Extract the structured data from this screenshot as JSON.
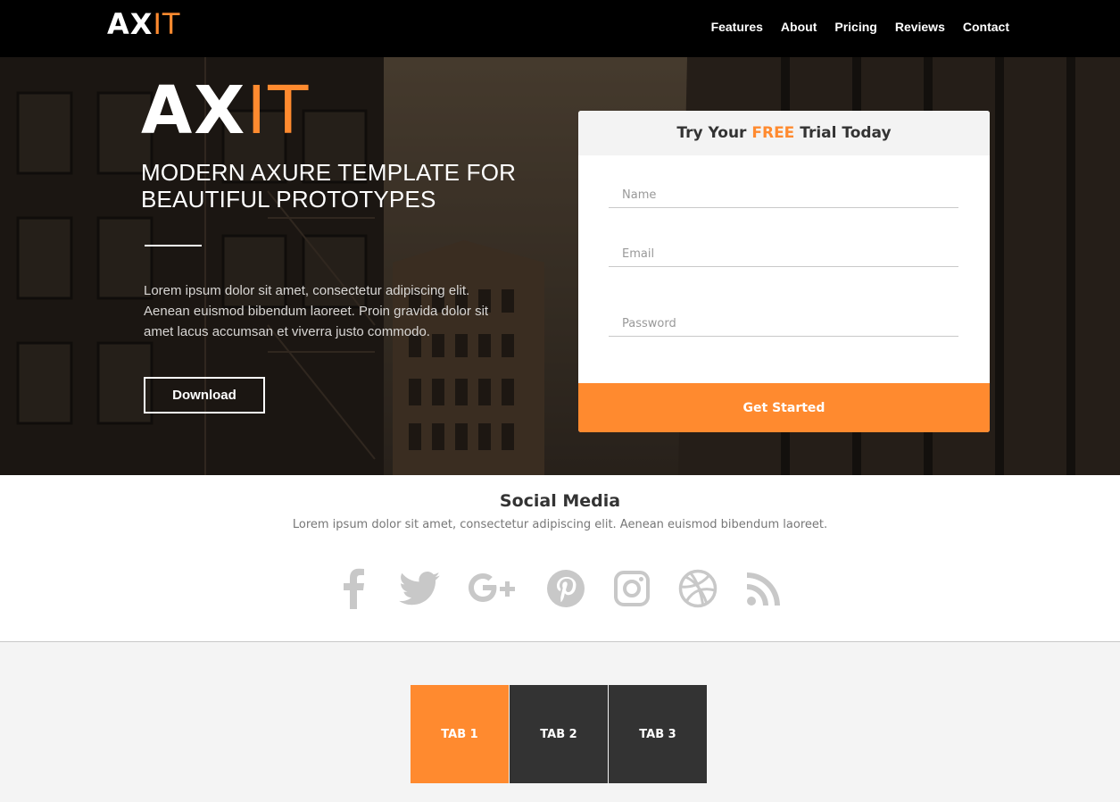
{
  "nav": {
    "logo_main": "AX",
    "logo_accent": "IT",
    "links": [
      "Features",
      "About",
      "Pricing",
      "Reviews",
      "Contact"
    ]
  },
  "hero": {
    "logo_main": "AX",
    "logo_accent": "IT",
    "title": "MODERN AXURE TEMPLATE FOR BEAUTIFUL PROTOTYPES",
    "description": "Lorem ipsum dolor sit amet, consectetur adipiscing elit. Aenean euismod bibendum laoreet. Proin gravida dolor sit amet lacus accumsan et viverra justo commodo.",
    "download_label": "Download"
  },
  "form": {
    "header_prefix": "Try Your ",
    "header_highlight": "FREE",
    "header_suffix": " Trial Today",
    "name_placeholder": "Name",
    "email_placeholder": "Email",
    "password_placeholder": "Password",
    "submit_label": "Get Started"
  },
  "social": {
    "title": "Social Media",
    "subtitle": "Lorem ipsum dolor sit amet, consectetur adipiscing elit. Aenean euismod bibendum laoreet.",
    "icons": [
      "facebook-icon",
      "twitter-icon",
      "google-plus-icon",
      "pinterest-icon",
      "instagram-icon",
      "dribbble-icon",
      "rss-icon"
    ]
  },
  "tabs": {
    "items": [
      "TAB 1",
      "TAB 2",
      "TAB 3"
    ],
    "active_index": 0
  },
  "colors": {
    "accent": "#ff8a2f",
    "nav_bg": "#000000",
    "tab_dark": "#333333",
    "icon_gray": "#c8c8c8"
  }
}
